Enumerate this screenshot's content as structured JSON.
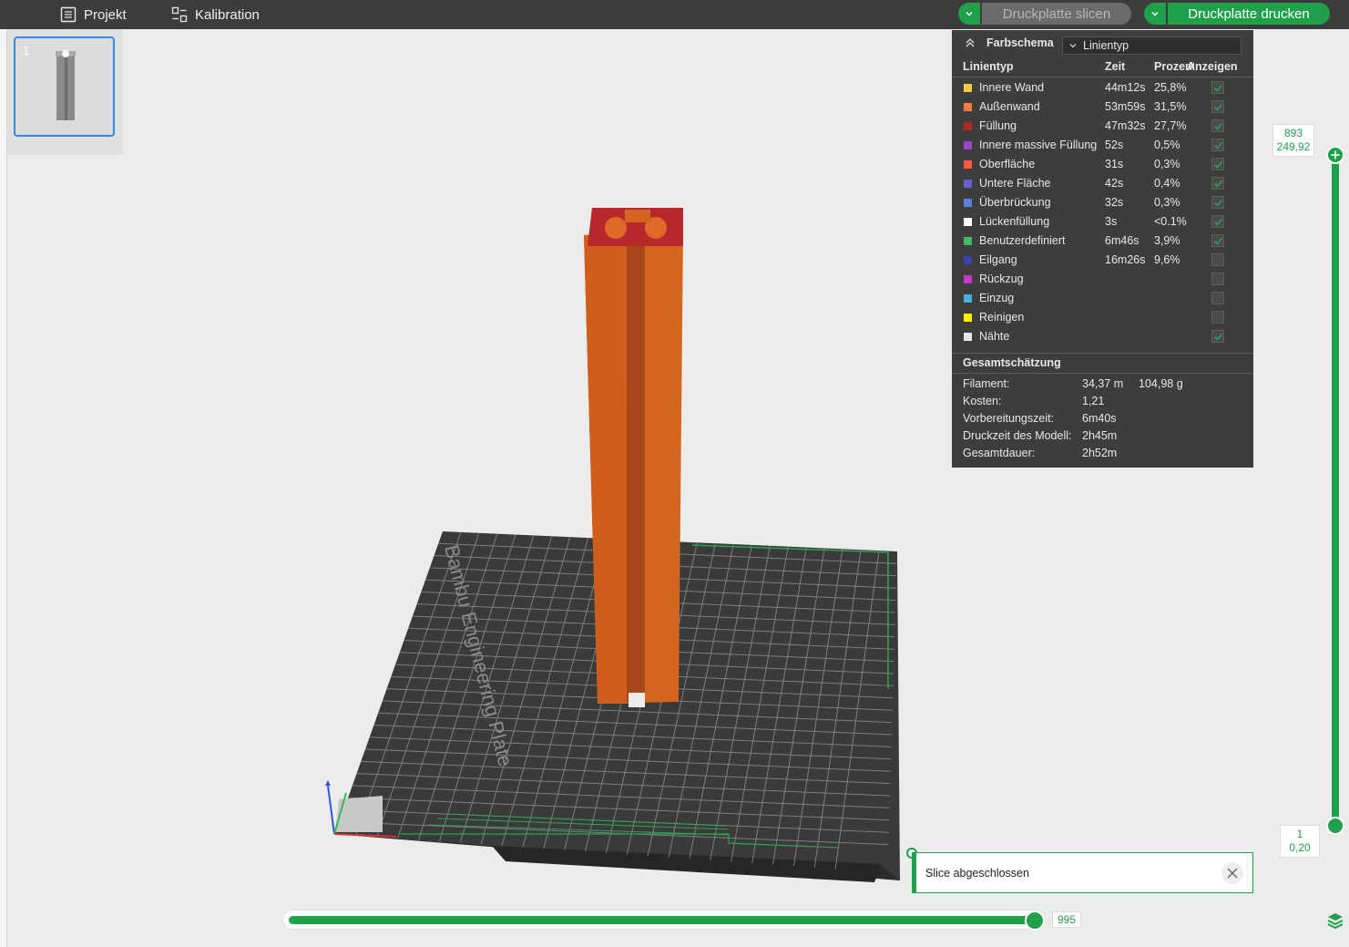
{
  "topbar": {
    "menu_project": "Projekt",
    "menu_calibration": "Kalibration",
    "slice_button": "Druckplatte slicen",
    "print_button": "Druckplatte drucken"
  },
  "plate": {
    "number": "1",
    "name": "Bambu Engineering Plate"
  },
  "legend": {
    "title": "Farbschema",
    "scheme": "Linientyp",
    "columns": {
      "type": "Linientyp",
      "time": "Zeit",
      "percent": "Prozent",
      "show": "Anzeigen"
    },
    "rows": [
      {
        "name": "Innere Wand",
        "time": "44m12s",
        "pct": "25,8%",
        "color": "#f5c842",
        "checked": true
      },
      {
        "name": "Außenwand",
        "time": "53m59s",
        "pct": "31,5%",
        "color": "#ff7a3d",
        "checked": true
      },
      {
        "name": "Füllung",
        "time": "47m32s",
        "pct": "27,7%",
        "color": "#b02a2a",
        "checked": true
      },
      {
        "name": "Innere massive Füllung",
        "time": "52s",
        "pct": "0,5%",
        "color": "#9b46c8",
        "checked": true
      },
      {
        "name": "Oberfläche",
        "time": "31s",
        "pct": "0,3%",
        "color": "#ff5a40",
        "checked": true
      },
      {
        "name": "Untere Fläche",
        "time": "42s",
        "pct": "0,4%",
        "color": "#6a5ed1",
        "checked": true
      },
      {
        "name": "Überbrückung",
        "time": "32s",
        "pct": "0,3%",
        "color": "#5a7fe0",
        "checked": true
      },
      {
        "name": "Lückenfüllung",
        "time": "3s",
        "pct": "<0.1%",
        "color": "#ffffff",
        "checked": true
      },
      {
        "name": "Benutzerdefiniert",
        "time": "6m46s",
        "pct": "3,9%",
        "color": "#45b86a",
        "checked": true
      },
      {
        "name": "Eilgang",
        "time": "16m26s",
        "pct": "9,6%",
        "color": "#3b3fb0",
        "checked": false
      },
      {
        "name": "Rückzug",
        "time": "",
        "pct": "",
        "color": "#c838c8",
        "checked": false
      },
      {
        "name": "Einzug",
        "time": "",
        "pct": "",
        "color": "#48b0d8",
        "checked": false
      },
      {
        "name": "Reinigen",
        "time": "",
        "pct": "",
        "color": "#ffee00",
        "checked": false
      },
      {
        "name": "Nähte",
        "time": "",
        "pct": "",
        "color": "#e6e6e6",
        "checked": true
      }
    ],
    "summary_title": "Gesamtschätzung",
    "summary": [
      {
        "label": "Filament:",
        "v1": "34,37 m",
        "v2": "104,98 g"
      },
      {
        "label": "Kosten:",
        "v1": "1,21",
        "v2": ""
      },
      {
        "label": "Vorbereitungszeit:",
        "v1": "6m40s",
        "v2": ""
      },
      {
        "label": "Druckzeit des Modell:",
        "v1": "2h45m",
        "v2": ""
      },
      {
        "label": "Gesamtdauer:",
        "v1": "2h52m",
        "v2": ""
      }
    ]
  },
  "vslider": {
    "top_layer": "893",
    "top_height": "249,92",
    "bottom_layer": "1",
    "bottom_height": "0,20"
  },
  "hslider": {
    "value": "995",
    "progress": 1.0
  },
  "notification": {
    "text": "Slice abgeschlossen"
  },
  "colors": {
    "accent": "#1ea14a",
    "model": "#d4651f",
    "model_top": "#b8272b",
    "plate": "#3a3a3a",
    "topbar": "#3c3c3c"
  }
}
